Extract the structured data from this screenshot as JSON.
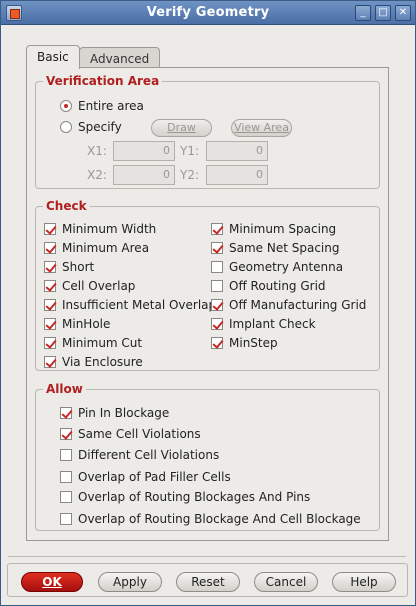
{
  "window": {
    "title": "Verify Geometry"
  },
  "tabs": [
    {
      "label": "Basic",
      "active": true
    },
    {
      "label": "Advanced",
      "active": false
    }
  ],
  "verification_area": {
    "title": "Verification Area",
    "entire_label": "Entire area",
    "specify_label": "Specify",
    "draw_label": "Draw",
    "view_area_label": "View Area",
    "x1_label": "X1:",
    "x1_value": "0",
    "y1_label": "Y1:",
    "y1_value": "0",
    "x2_label": "X2:",
    "x2_value": "0",
    "y2_label": "Y2:",
    "y2_value": "0"
  },
  "check": {
    "title": "Check",
    "left": [
      {
        "label": "Minimum Width",
        "checked": true
      },
      {
        "label": "Minimum Area",
        "checked": true
      },
      {
        "label": "Short",
        "checked": true
      },
      {
        "label": "Cell Overlap",
        "checked": true
      },
      {
        "label": "Insufficient Metal Overlap",
        "checked": true
      },
      {
        "label": "MinHole",
        "checked": true
      },
      {
        "label": "Minimum Cut",
        "checked": true
      },
      {
        "label": "Via Enclosure",
        "checked": true
      }
    ],
    "right": [
      {
        "label": "Minimum Spacing",
        "checked": true
      },
      {
        "label": "Same Net Spacing",
        "checked": true
      },
      {
        "label": "Geometry Antenna",
        "checked": false
      },
      {
        "label": "Off Routing Grid",
        "checked": false
      },
      {
        "label": "Off Manufacturing Grid",
        "checked": true
      },
      {
        "label": "Implant Check",
        "checked": true
      },
      {
        "label": "MinStep",
        "checked": true
      }
    ]
  },
  "allow": {
    "title": "Allow",
    "items": [
      {
        "label": "Pin In Blockage",
        "checked": true
      },
      {
        "label": "Same Cell Violations",
        "checked": true
      },
      {
        "label": "Different Cell Violations",
        "checked": false
      },
      {
        "label": "Overlap of Pad Filler Cells",
        "checked": false
      },
      {
        "label": "Overlap of Routing Blockages And Pins",
        "checked": false
      },
      {
        "label": "Overlap of Routing Blockage And Cell Blockage",
        "checked": false
      }
    ]
  },
  "buttons": {
    "ok": "OK",
    "apply": "Apply",
    "reset": "Reset",
    "cancel": "Cancel",
    "help": "Help"
  },
  "colors": {
    "accent": "#c62828",
    "titlebar": "#4a6ea6"
  }
}
